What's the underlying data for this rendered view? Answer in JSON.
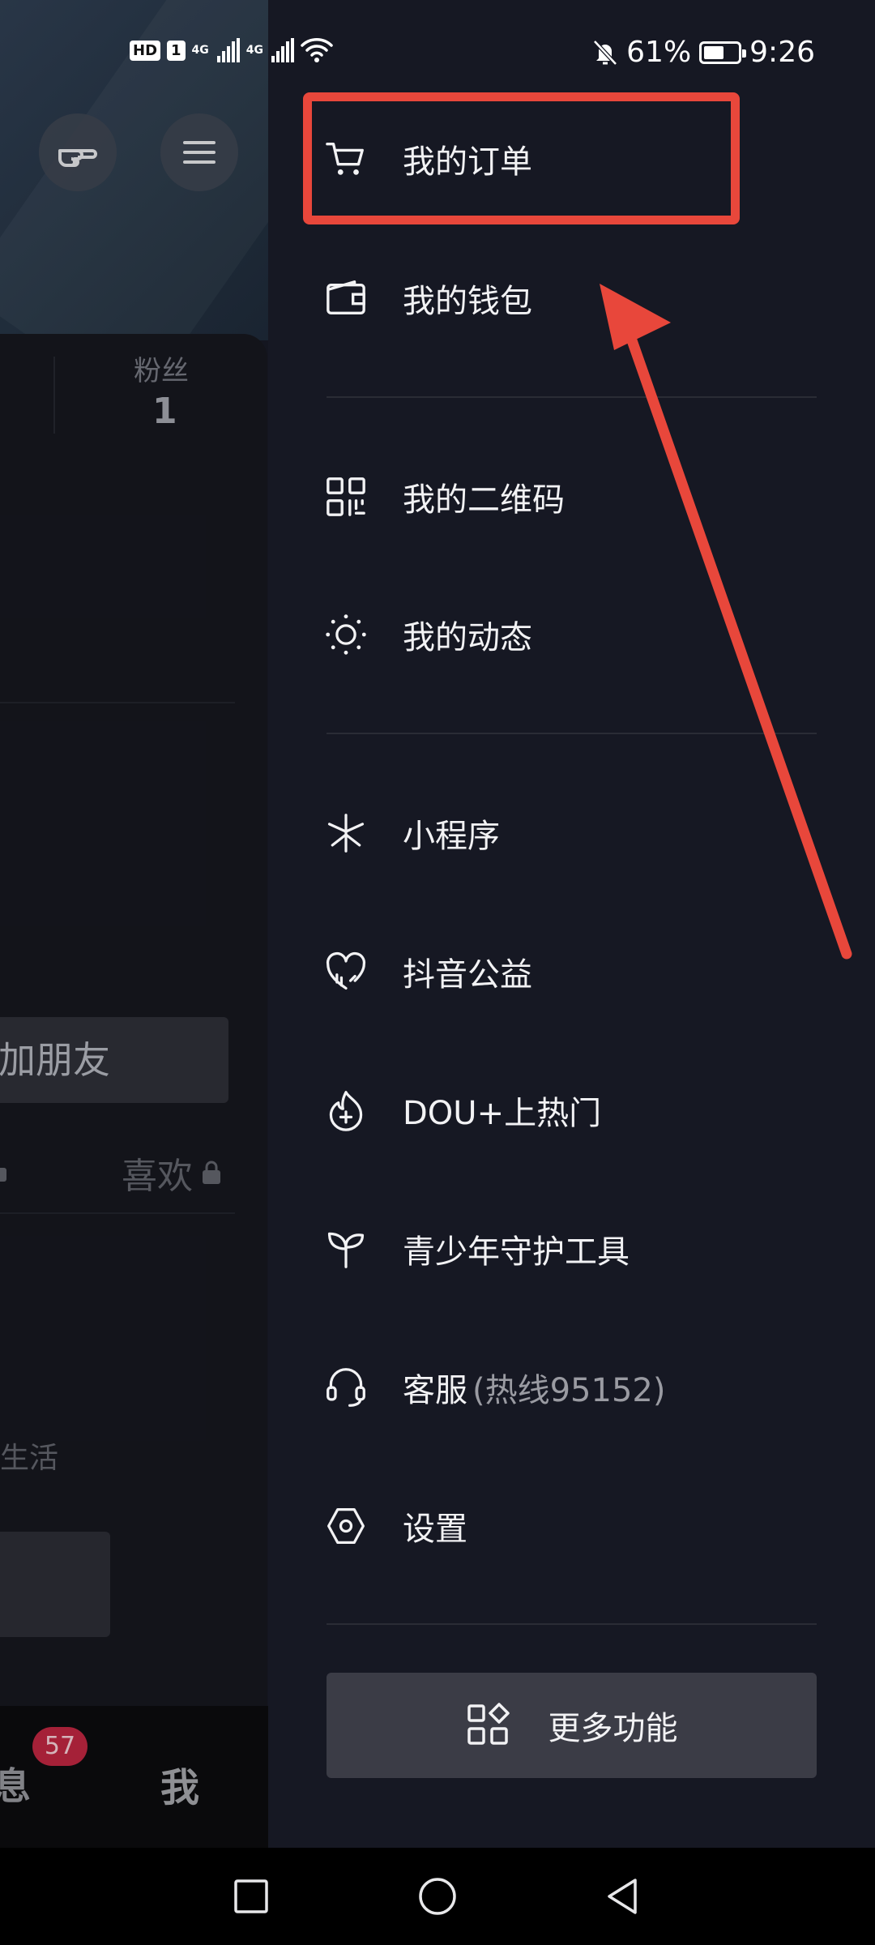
{
  "status_bar": {
    "hd": "HD",
    "sim": "1",
    "network_1": "4G",
    "network_2": "4G",
    "battery_percent": "61%",
    "battery_level": 0.61,
    "time": "9:26"
  },
  "left_page": {
    "stat_label": "粉丝",
    "stat_value": "1",
    "add_friend": "加朋友",
    "likes_tab": "喜欢",
    "live_text": "生活",
    "message_badge": "57",
    "message_tab": "息",
    "me_tab": "我"
  },
  "drawer": {
    "items": [
      {
        "label": "我的订单",
        "icon": "cart-icon"
      },
      {
        "label": "我的钱包",
        "icon": "wallet-icon"
      },
      {
        "label": "我的二维码",
        "icon": "qr-code-icon"
      },
      {
        "label": "我的动态",
        "icon": "activity-icon"
      },
      {
        "label": "小程序",
        "icon": "mini-program-icon"
      },
      {
        "label": "抖音公益",
        "icon": "charity-heart-icon"
      },
      {
        "label": "DOU+上热门",
        "icon": "dou-plus-icon"
      },
      {
        "label": "青少年守护工具",
        "icon": "sprout-icon"
      },
      {
        "label": "客服",
        "sub": "(热线95152)",
        "icon": "headset-icon"
      },
      {
        "label": "设置",
        "icon": "settings-icon"
      }
    ],
    "more_button": "更多功能"
  },
  "annotation": {
    "color": "#e8473b"
  },
  "colors": {
    "background": "#161823",
    "button": "#3b3c46",
    "badge": "#b3243d"
  }
}
